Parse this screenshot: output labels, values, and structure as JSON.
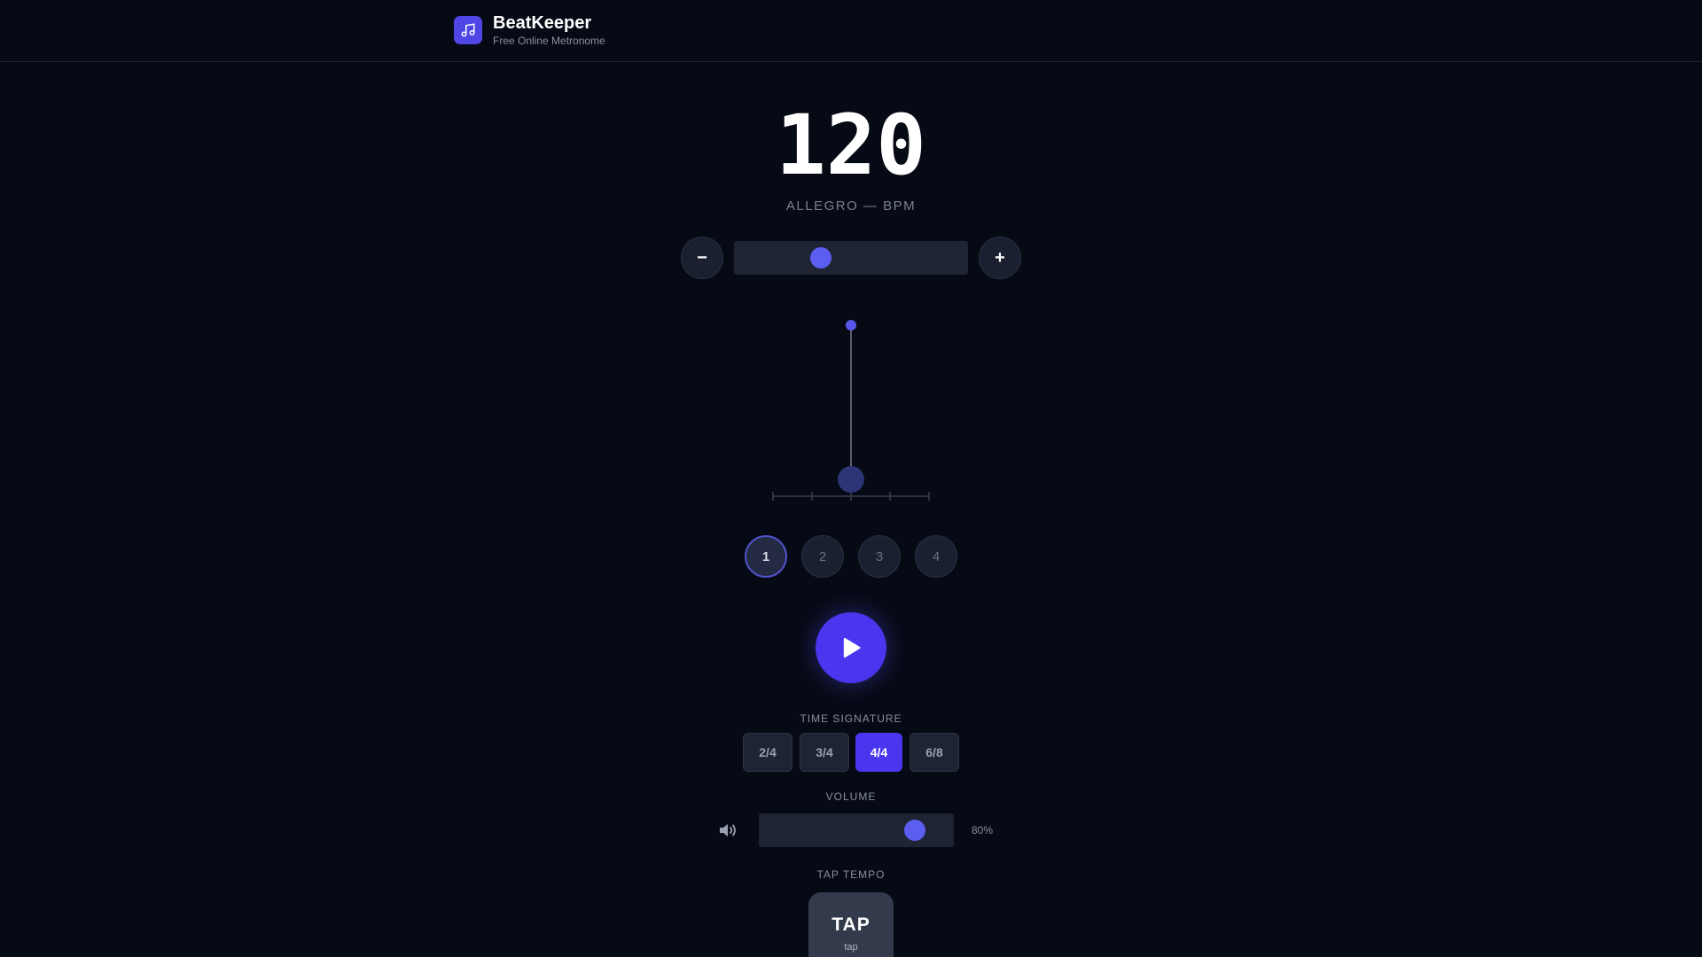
{
  "header": {
    "app_name": "BeatKeeper",
    "subtitle": "Free Online Metronome",
    "logo_icon": "music-note-icon"
  },
  "tempo": {
    "bpm": "120",
    "label": "ALLEGRO — BPM",
    "decrease_label": "−",
    "increase_label": "+",
    "slider_fraction": 0.37
  },
  "beats": {
    "dots": [
      "1",
      "2",
      "3",
      "4"
    ],
    "active_index": 0
  },
  "playback": {
    "play_icon": "play-icon"
  },
  "time_signature": {
    "label": "TIME SIGNATURE",
    "options": [
      "2/4",
      "3/4",
      "4/4",
      "6/8"
    ],
    "selected": "4/4"
  },
  "volume": {
    "label": "VOLUME",
    "value_text": "80%",
    "fraction": 0.8,
    "icon": "speaker-icon"
  },
  "tap_tempo": {
    "label": "TAP TEMPO",
    "button_text": "TAP",
    "button_sub": "tap"
  },
  "colors": {
    "background": "#060a14",
    "accent": "#4a36ee",
    "thumb": "#5b5ef0",
    "surface": "#1e2433"
  }
}
